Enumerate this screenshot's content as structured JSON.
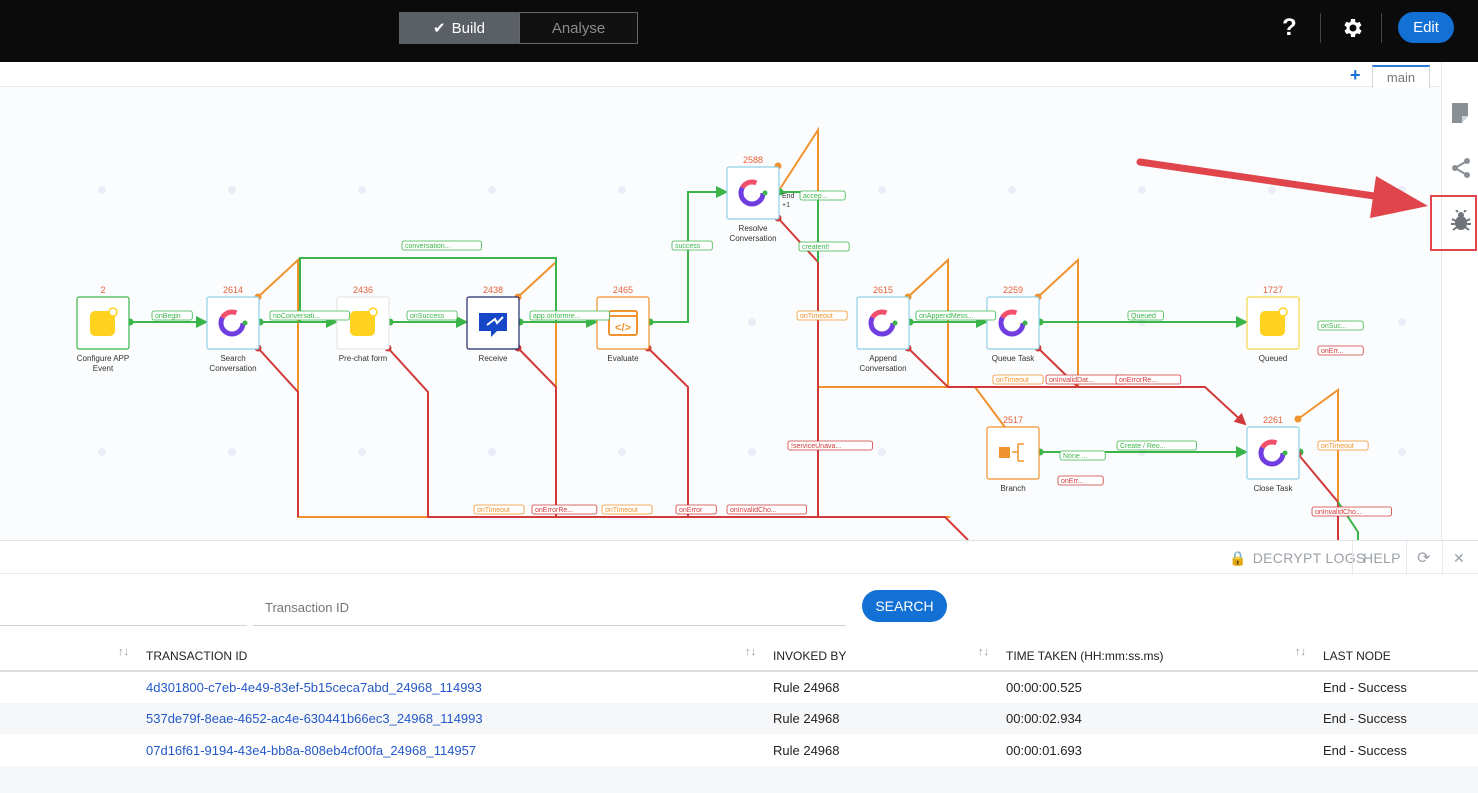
{
  "header": {
    "tab_build": "Build",
    "tab_analyse": "Analyse",
    "help_label": "?",
    "edit_label": "Edit"
  },
  "canvas": {
    "add_flow_label": "+",
    "flow_tab": "main",
    "nodes": [
      {
        "id": "2",
        "name": "Configure APP Event"
      },
      {
        "id": "2614",
        "name": "Search Conversation"
      },
      {
        "id": "2436",
        "name": "Pre-chat form"
      },
      {
        "id": "2438",
        "name": "Receive"
      },
      {
        "id": "2465",
        "name": "Evaluate"
      },
      {
        "id": "2588",
        "name": "Resolve Conversation"
      },
      {
        "id": "2615",
        "name": "Append Conversation"
      },
      {
        "id": "2259",
        "name": "Queue Task"
      },
      {
        "id": "1727",
        "name": "Queued"
      },
      {
        "id": "2517",
        "name": "Branch"
      },
      {
        "id": "2261",
        "name": "Close Task"
      }
    ],
    "edge_labels": [
      "onBegin",
      "noConversati...",
      "onSuccess",
      "app.onformre...",
      "success",
      "conversation...",
      "onAppendMess...",
      "Queued",
      "onTimeout",
      "Create / Reo...",
      "creatent!",
      "accep...",
      "End",
      "+1",
      "onSuc...",
      "onErr...",
      "None ...",
      "onErr...",
      "onTimeout",
      "!serviceUnava...",
      "onTimeout",
      "onInvalidDat...",
      "onErrorRe...",
      "onTimeout",
      "onErrorRe...",
      "onTimeout",
      "onError",
      "onInvalidCho...",
      "onInvalidCho..."
    ]
  },
  "logs": {
    "decrypt_label": "DECRYPT LOGS",
    "help_label": "HELP",
    "refresh_label": "⟳",
    "close_label": "✕",
    "transaction_placeholder": "Transaction ID",
    "search_label": "SEARCH",
    "columns": [
      "TRANSACTION ID",
      "INVOKED BY",
      "TIME TAKEN (HH:mm:ss.ms)",
      "LAST NODE"
    ],
    "rows": [
      {
        "transaction_id": "4d301800-c7eb-4e49-83ef-5b15ceca7abd_24968_114993",
        "invoked_by": "Rule 24968",
        "time_taken": "00:00:00.525",
        "last_node": "End - Success"
      },
      {
        "transaction_id": "537de79f-8eae-4652-ac4e-630441b66ec3_24968_114993",
        "invoked_by": "Rule 24968",
        "time_taken": "00:00:02.934",
        "last_node": "End - Success"
      },
      {
        "transaction_id": "07d16f61-9194-43e4-bb8a-808eb4cf00fa_24968_114957",
        "invoked_by": "Rule 24968",
        "time_taken": "00:00:01.693",
        "last_node": "End - Success"
      }
    ]
  },
  "colors": {
    "accent": "#1370d4",
    "success": "#3bb54a",
    "timeout": "#f0922e",
    "error": "#d03a3a",
    "highlight": "#e0454b"
  }
}
